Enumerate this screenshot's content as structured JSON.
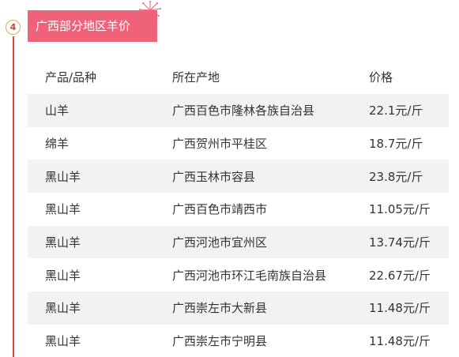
{
  "step": {
    "number": "4"
  },
  "section": {
    "title": "广西部分地区羊价"
  },
  "table": {
    "headers": [
      "产品/品种",
      "所在产地",
      "价格"
    ],
    "rows": [
      {
        "product": "山羊",
        "origin": "广西百色市隆林各族自治县",
        "price": "22.1元/斤"
      },
      {
        "product": "绵羊",
        "origin": "广西贺州市平桂区",
        "price": "18.7元/斤"
      },
      {
        "product": "黑山羊",
        "origin": "广西玉林市容县",
        "price": "23.8元/斤"
      },
      {
        "product": "黑山羊",
        "origin": "广西百色市靖西市",
        "price": "11.05元/斤"
      },
      {
        "product": "黑山羊",
        "origin": "广西河池市宜州区",
        "price": "13.74元/斤"
      },
      {
        "product": "黑山羊",
        "origin": "广西河池市环江毛南族自治县",
        "price": "22.67元/斤"
      },
      {
        "product": "黑山羊",
        "origin": "广西崇左市大新县",
        "price": "11.48元/斤"
      },
      {
        "product": "黑山羊",
        "origin": "广西崇左市宁明县",
        "price": "11.48元/斤"
      }
    ]
  },
  "colors": {
    "accent": "#f0627a",
    "timeline": "#e0453b",
    "badge_border": "#e6a93a",
    "row_shade": "#f2f2f2"
  },
  "icons": [
    "sparkle-icon"
  ]
}
